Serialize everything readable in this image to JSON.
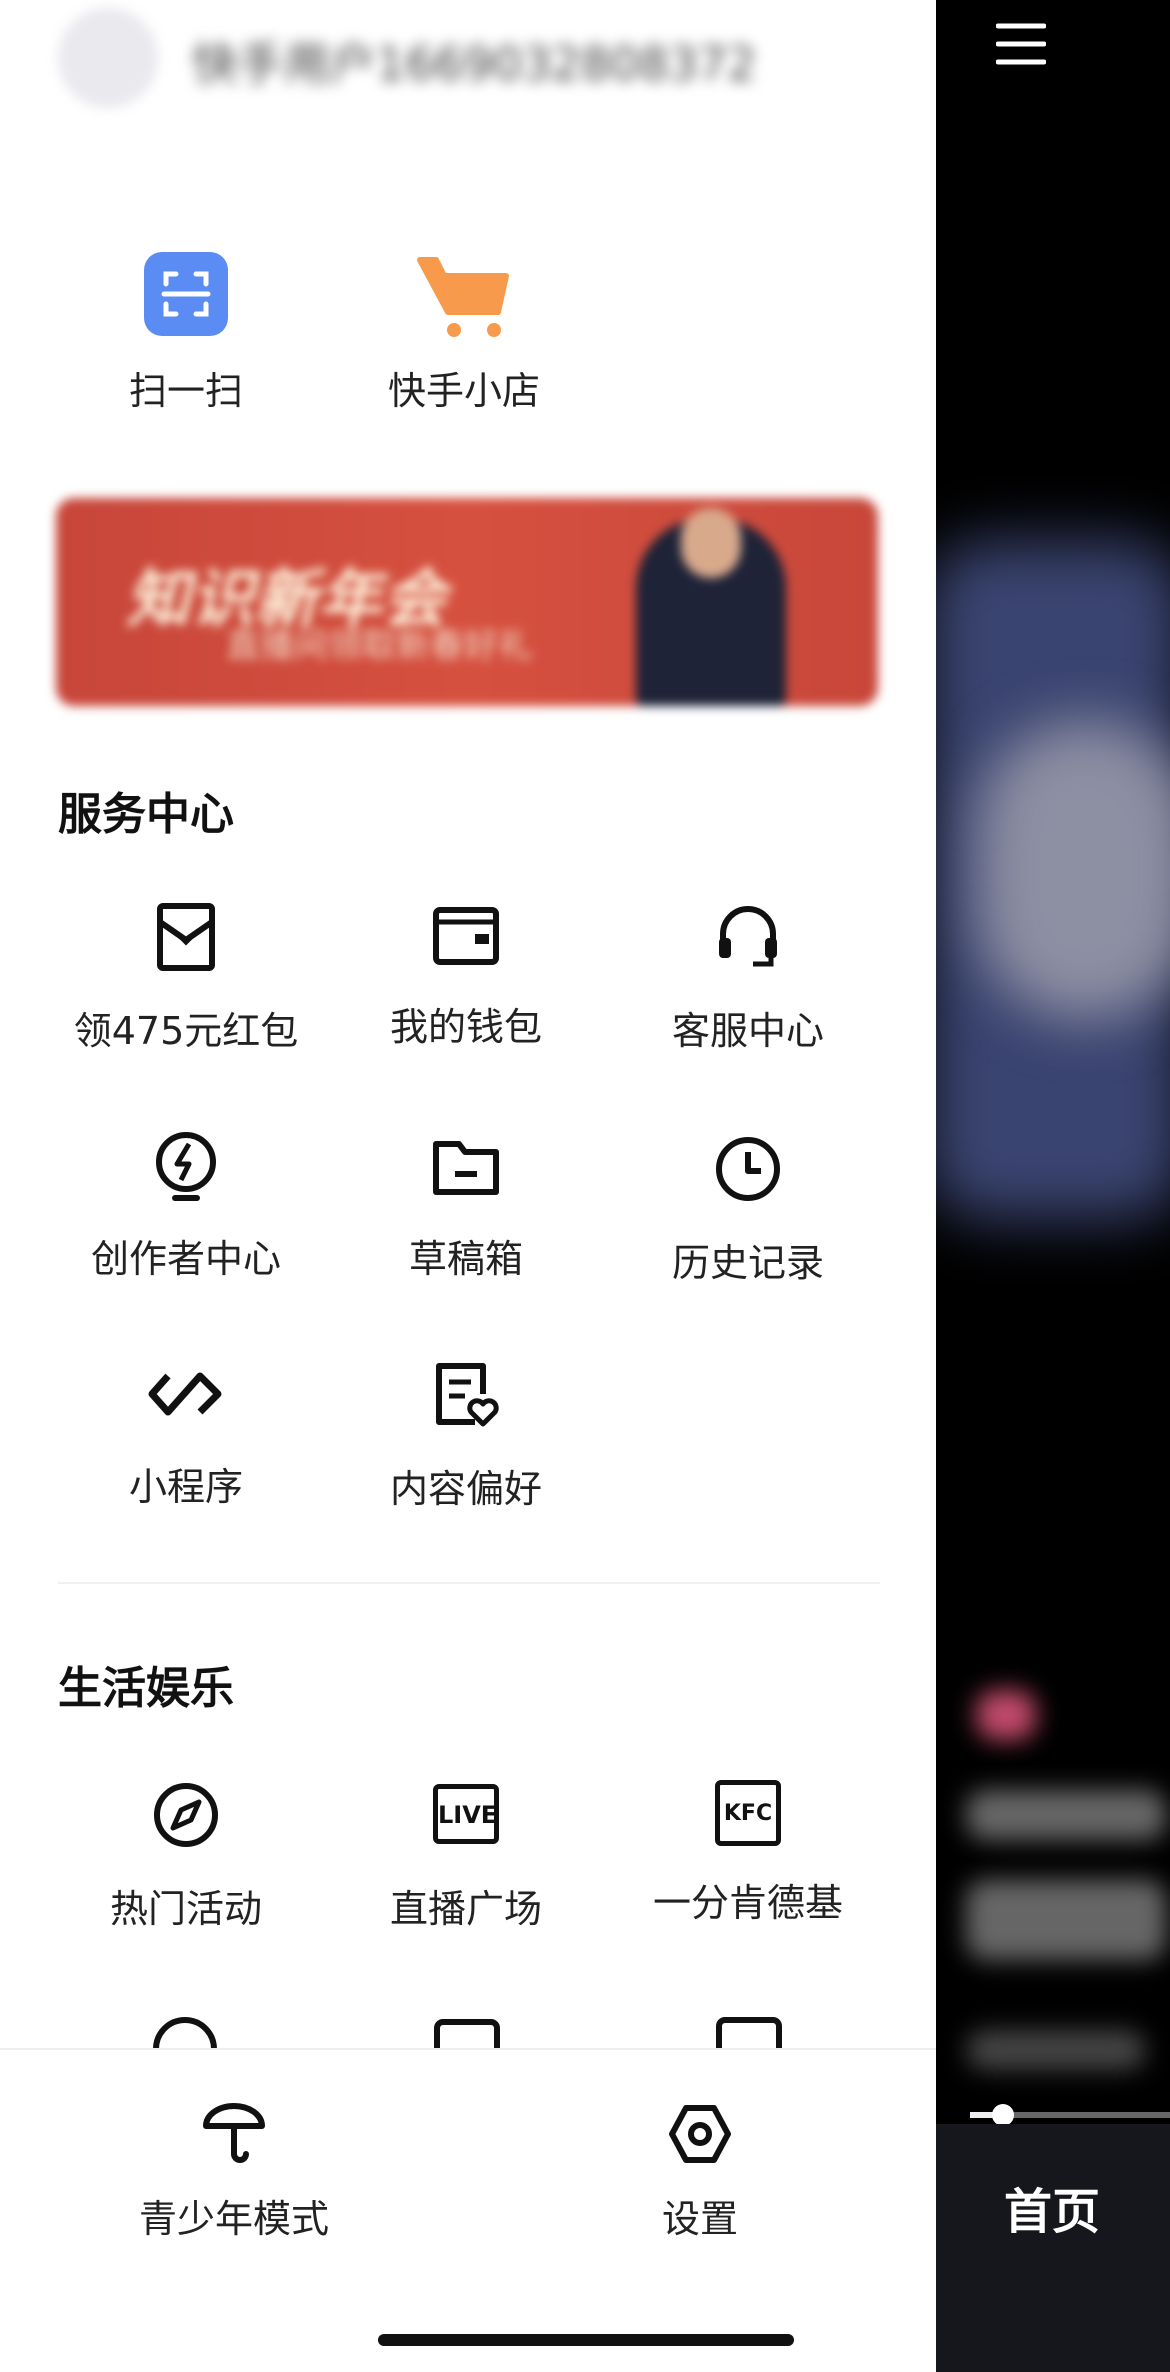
{
  "profile": {
    "username": "快手用户1669032808372"
  },
  "quick_actions": [
    {
      "label": "扫一扫",
      "icon": "scan-icon"
    },
    {
      "label": "快手小店",
      "icon": "cart-icon"
    }
  ],
  "banner": {
    "text": "知识新年会",
    "subtext": "直播间领取新春好礼"
  },
  "service": {
    "title": "服务中心",
    "items": [
      {
        "label": "领475元红包",
        "icon": "red-packet-icon"
      },
      {
        "label": "我的钱包",
        "icon": "wallet-icon"
      },
      {
        "label": "客服中心",
        "icon": "headset-icon"
      },
      {
        "label": "创作者中心",
        "icon": "bulb-lightning-icon"
      },
      {
        "label": "草稿箱",
        "icon": "folder-icon"
      },
      {
        "label": "历史记录",
        "icon": "clock-icon"
      },
      {
        "label": "小程序",
        "icon": "mini-program-icon"
      },
      {
        "label": "内容偏好",
        "icon": "content-preference-icon"
      }
    ]
  },
  "life": {
    "title": "生活娱乐",
    "items": [
      {
        "label": "热门活动",
        "icon": "compass-icon"
      },
      {
        "label": "直播广场",
        "icon": "live-icon",
        "glyph": "LIVE"
      },
      {
        "label": "一分肯德基",
        "icon": "kfc-icon",
        "glyph": "KFC"
      }
    ]
  },
  "bottom": {
    "youth_mode": "青少年模式",
    "settings": "设置"
  },
  "right_panel": {
    "menu_icon": "hamburger-menu-icon",
    "tab_home": "首页"
  },
  "colors": {
    "scan_blue": "#5b8cf4",
    "cart_orange": "#f79a4c",
    "banner_red": "#d6503f"
  }
}
